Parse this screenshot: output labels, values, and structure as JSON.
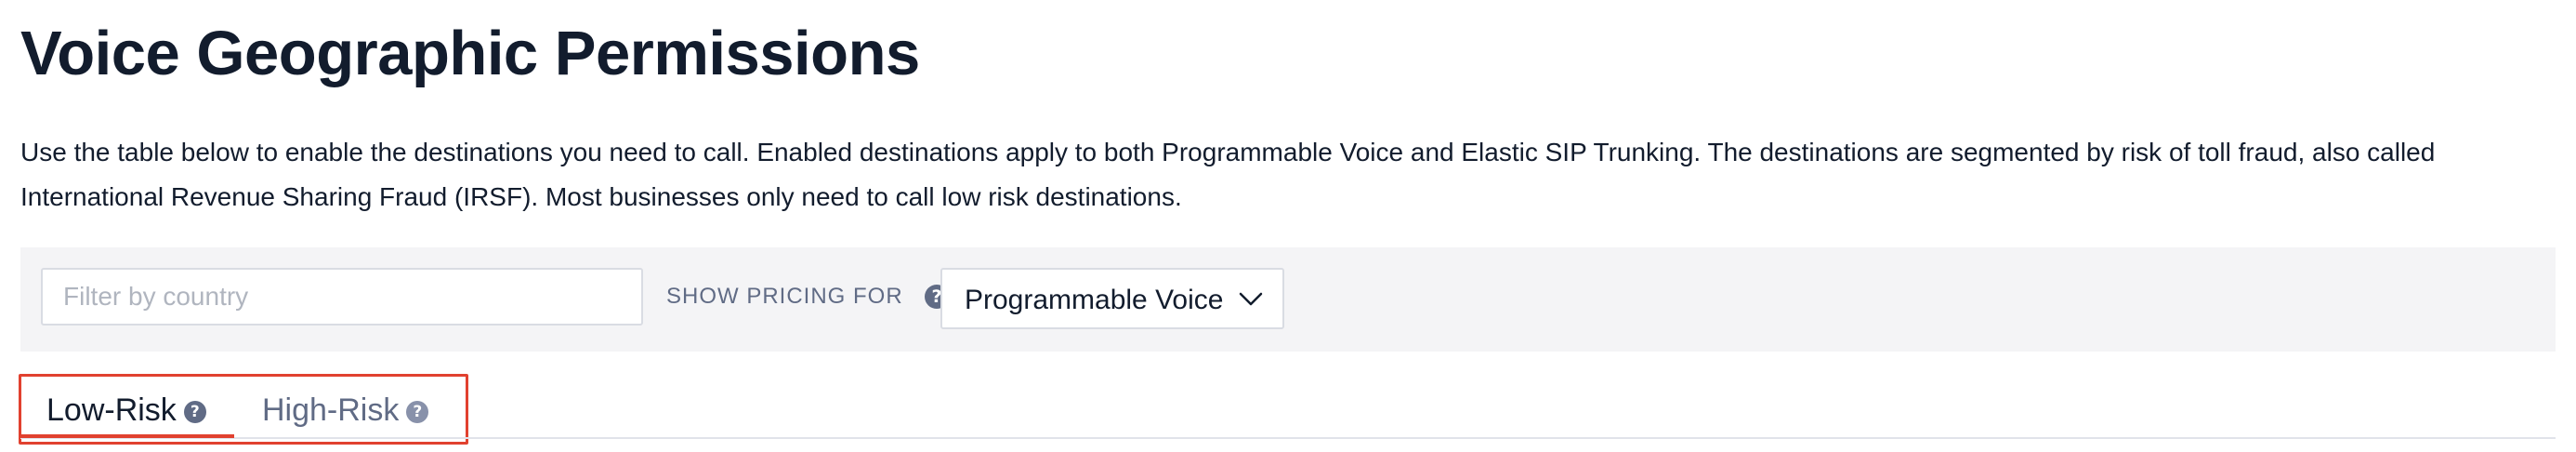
{
  "page": {
    "title": "Voice Geographic Permissions",
    "description": "Use the table below to enable the destinations you need to call. Enabled destinations apply to both Programmable Voice and Elastic SIP Trunking. The destinations are segmented by risk of toll fraud, also called International Revenue Sharing Fraud (IRSF). Most businesses only need to call low risk destinations."
  },
  "filter_bar": {
    "filter_placeholder": "Filter by country",
    "filter_value": "",
    "pricing_label": "SHOW PRICING FOR",
    "pricing_help_icon": "help-icon",
    "pricing_selected": "Programmable Voice",
    "pricing_chevron_icon": "chevron-down-icon"
  },
  "tabs": [
    {
      "label": "Low-Risk",
      "active": true,
      "icon": "help-icon"
    },
    {
      "label": "High-Risk",
      "active": false,
      "icon": "help-icon"
    }
  ],
  "colors": {
    "title_text": "#121c2d",
    "muted_text": "#606b85",
    "active_tab_underline": "#e1412f",
    "highlight_box": "#e1412f",
    "filter_bar_bg": "#f4f4f6"
  },
  "help_glyph": "?"
}
